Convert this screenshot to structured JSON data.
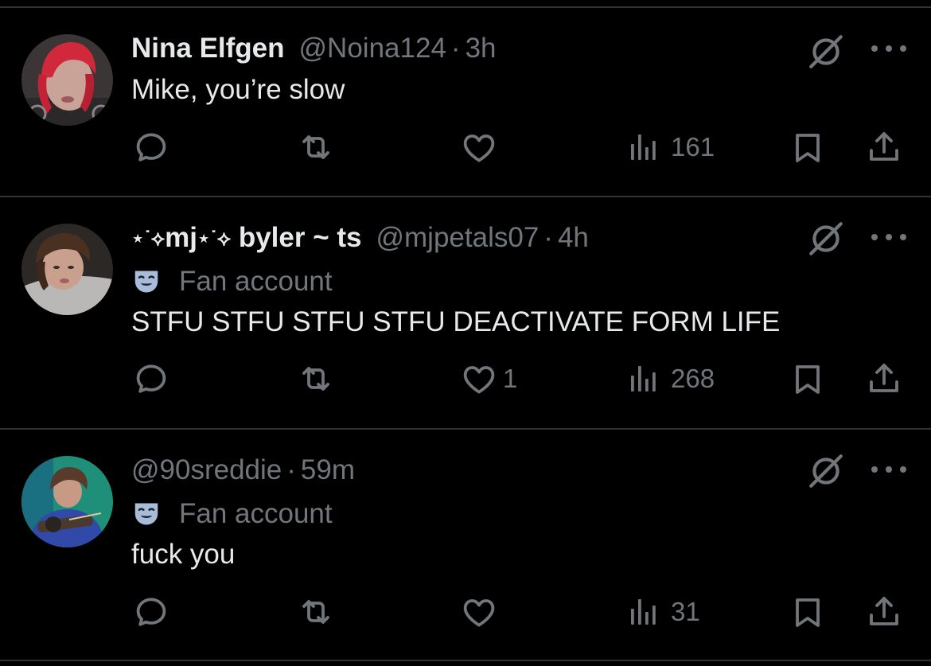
{
  "tweets": [
    {
      "name": "Nina Elfgen",
      "handle": "@Noina124",
      "separator": "·",
      "time": "3h",
      "text": "Mike, you’re slow",
      "stats": {
        "replies": "",
        "reposts": "",
        "likes": "",
        "views": "161"
      }
    },
    {
      "name_prefix": "⋆˙⟡",
      "name_main": "mj",
      "name_mid": "⋆˙⟡",
      "name_rest": " byler ~ ts",
      "handle": "@mjpetals07",
      "separator": "·",
      "time": "4h",
      "badge": "Fan account",
      "text": "STFU STFU STFU STFU DEACTIVATE FORM LIFE",
      "stats": {
        "replies": "",
        "reposts": "",
        "likes": "1",
        "views": "268"
      }
    },
    {
      "handle": "@90sreddie",
      "separator": "·",
      "time": "59m",
      "badge": "Fan account",
      "text": "fuck you",
      "stats": {
        "replies": "",
        "reposts": "",
        "likes": "",
        "views": "31"
      }
    }
  ],
  "colors": {
    "background": "#000000",
    "primary_text": "#e7e9ea",
    "secondary_text": "#71767b",
    "divider": "#2f3336",
    "mask_icon": "#a8bbd8"
  },
  "icons": [
    "grok-icon",
    "more-icon",
    "reply-icon",
    "repost-icon",
    "like-icon",
    "views-icon",
    "bookmark-icon",
    "share-icon",
    "theater-mask-icon"
  ]
}
